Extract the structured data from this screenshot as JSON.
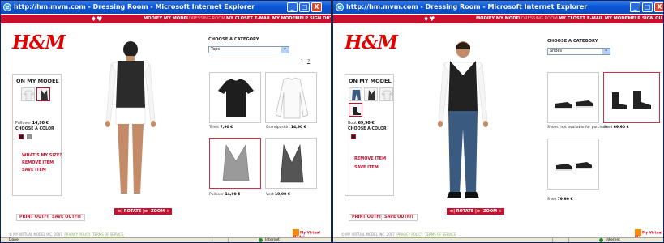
{
  "window_title": "http://hm.mvm.com - Dressing Room - Microsoft Internet Explorer",
  "title_buttons": {
    "minimize": "_",
    "maximize": "□",
    "close": "X"
  },
  "nav": {
    "model_symbol": "♦♥",
    "items": [
      "MODIFY MY MODEL",
      "DRESSING ROOM",
      "MY CLOSET",
      "E-MAIL MY MODEL",
      "HELP",
      "SIGN OUT"
    ],
    "right_items": [
      "MODIFY MY MODEL",
      "DRESSING ROOM",
      "MY CLOSET",
      "E-MAIL MY MODEL",
      "HELP",
      "SIGN OU"
    ]
  },
  "logo": "H&M",
  "on_my_model": "ON MY MODEL",
  "choose_color": "CHOOSE A COLOR",
  "choose_category": "CHOOSE A CATEGORY",
  "left": {
    "item_name": "Pullover",
    "item_price": "14,90 €",
    "category": "Tops",
    "pages": [
      "1",
      "2"
    ],
    "links": [
      "WHAT'S MY SIZE?",
      "REMOVE ITEM",
      "SAVE ITEM"
    ],
    "products": [
      {
        "name": "Tshirt",
        "price": "7,90 €"
      },
      {
        "name": "Grandpashirt",
        "price": "14,90 €"
      },
      {
        "name": "Pullover",
        "price": "14,90 €"
      },
      {
        "name": "Vest",
        "price": "19,90 €"
      }
    ],
    "status": "Done",
    "zone": "Internet"
  },
  "right": {
    "item_name": "Boot",
    "item_price": "69,90 €",
    "category": "Shoes",
    "links": [
      "REMOVE ITEM",
      "SAVE ITEM"
    ],
    "products": [
      {
        "name": "Shoes, not available for purchase",
        "price": ""
      },
      {
        "name": "Boot",
        "price": "69,90 €"
      },
      {
        "name": "Shoe",
        "price": "79,90 €"
      }
    ],
    "status": "",
    "zone": "Internet"
  },
  "print_outfit": "PRINT OUTFIT",
  "save_outfit": "SAVE OUTFIT",
  "rotate": "≪| ROTATE |≫",
  "zoom": "ZOOM",
  "zoom_icon": "+",
  "footer": {
    "copyright": "© MY VIRTUAL MODEL INC. 2007",
    "privacy": "PRIVACY POLICY",
    "terms": "TERMS OF SERVICE"
  },
  "vm_badge": {
    "line1": "My Virtual Model",
    "line2": "experience"
  },
  "vm_badge_right": {
    "line1": "My Virtual Mo",
    "line2": "experience"
  }
}
